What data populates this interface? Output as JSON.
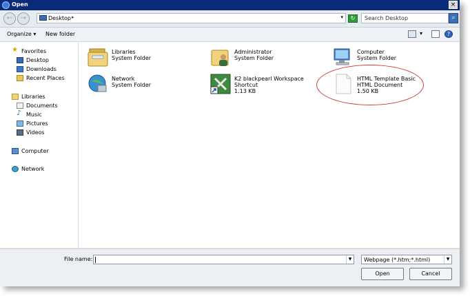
{
  "window": {
    "title": "Open"
  },
  "address": {
    "location": "Desktop",
    "separator": "▸",
    "dropdown": "▾"
  },
  "search": {
    "placeholder": "Search Desktop"
  },
  "toolbar": {
    "organize": "Organize ▾",
    "new_folder": "New folder",
    "view_dropdown": "▾"
  },
  "sidebar": {
    "favorites_header": "Favorites",
    "favorites": [
      "Desktop",
      "Downloads",
      "Recent Places"
    ],
    "libraries_header": "Libraries",
    "libraries": [
      "Documents",
      "Music",
      "Pictures",
      "Videos"
    ],
    "computer": "Computer",
    "network": "Network"
  },
  "items": [
    {
      "name": "Libraries",
      "type": "System Folder",
      "icon": "libraries-icon"
    },
    {
      "name": "Administrator",
      "type": "System Folder",
      "icon": "user-folder-icon"
    },
    {
      "name": "Computer",
      "type": "System Folder",
      "icon": "computer-icon"
    },
    {
      "name": "Network",
      "type": "System Folder",
      "icon": "network-icon"
    },
    {
      "name": "K2 blackpearl Workspace",
      "type": "Shortcut",
      "size": "1.13 KB",
      "icon": "shortcut-tools-icon"
    },
    {
      "name": "HTML Template Basic",
      "type": "HTML Document",
      "size": "1.50 KB",
      "icon": "html-document-icon"
    }
  ],
  "footer": {
    "file_name_label": "File name:",
    "file_name_value": "",
    "file_type": "Webpage (*.htm;*.html)",
    "open_label": "Open",
    "cancel_label": "Cancel"
  },
  "colors": {
    "titlebar": "#0a2a7a",
    "highlight": "#d23a3a"
  }
}
